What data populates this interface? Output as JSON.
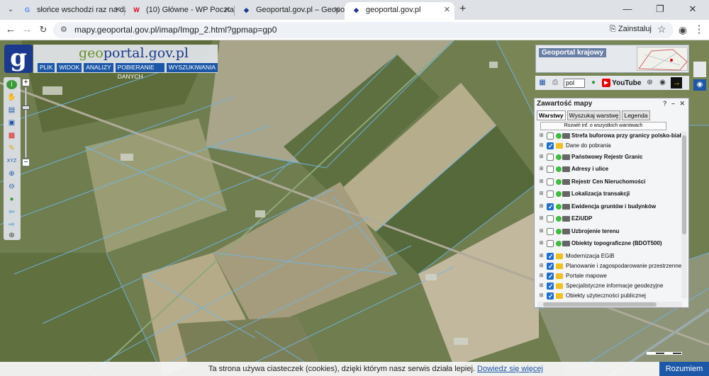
{
  "browser": {
    "tabs": [
      {
        "title": "słońce wschodzi raz na dzień -",
        "favicon": "G",
        "fav_color": "#4285f4",
        "active": false
      },
      {
        "title": "(10) Główne - WP Poczta",
        "favicon": "W",
        "fav_color": "#e2001a",
        "active": false
      },
      {
        "title": "Geoportal.gov.pl – Geoportal In",
        "favicon": "◆",
        "fav_color": "#1b3a8f",
        "active": false
      },
      {
        "title": "geoportal.gov.pl",
        "favicon": "◆",
        "fav_color": "#1b3a8f",
        "active": true
      }
    ],
    "url": "mapy.geoportal.gov.pl/imap/Imgp_2.html?gpmap=gp0",
    "install_label": "Zainstaluj"
  },
  "geoportal": {
    "brand_prefix": "geo",
    "brand_suffix": "portal.gov.pl",
    "menu": [
      "PLIK",
      "WIDOK",
      "ANALIZY",
      "POBIERANIE DANYCH",
      "WYSZUKIWANIA"
    ],
    "overview_title": "Geoportal krajowy",
    "lang": "pol",
    "youtube_label": "YouTube"
  },
  "panel": {
    "title": "Zawartość mapy",
    "tabs": [
      "Warstwy",
      "Wyszukaj warstwę",
      "Legenda"
    ],
    "expand_button": "Rozwiń inf. o wszystkich warstwach",
    "layers": [
      {
        "name": "Strefa buforowa przy granicy polsko-białor",
        "kind": "service",
        "checked": false,
        "bold": true
      },
      {
        "name": "Dane do pobrania",
        "kind": "folder",
        "checked": true,
        "bold": false
      },
      {
        "name": "Państwowy Rejestr Granic",
        "kind": "service",
        "checked": false,
        "bold": true
      },
      {
        "name": "Adresy i ulice",
        "kind": "service",
        "checked": false,
        "bold": true
      },
      {
        "name": "Rejestr Cen Nieruchomości",
        "kind": "service",
        "checked": false,
        "bold": true
      },
      {
        "name": "Lokalizacja transakcji",
        "kind": "service",
        "checked": false,
        "bold": true
      },
      {
        "name": "Ewidencja gruntów i budynków",
        "kind": "service",
        "checked": true,
        "bold": true
      },
      {
        "name": "EZiUDP",
        "kind": "service",
        "checked": false,
        "bold": true
      },
      {
        "name": "Uzbrojenie terenu",
        "kind": "service",
        "checked": false,
        "bold": true
      },
      {
        "name": "Obiekty topograficzne (BDOT500)",
        "kind": "service",
        "checked": false,
        "bold": true
      },
      {
        "name": "Modernizacja EGiB",
        "kind": "folder",
        "checked": true,
        "bold": false
      },
      {
        "name": "Planowanie i zagospodarowanie przestrzenne",
        "kind": "folder",
        "checked": true,
        "bold": false
      },
      {
        "name": "Portale mapowe",
        "kind": "folder",
        "checked": true,
        "bold": false
      },
      {
        "name": "Specjalistyczne informacje geodezyjne",
        "kind": "folder",
        "checked": true,
        "bold": false
      },
      {
        "name": "Obiekty użyteczności publicznej",
        "kind": "folder",
        "checked": true,
        "bold": false
      }
    ]
  },
  "cookie": {
    "text": "Ta strona używa ciasteczek (cookies), dzięki którym nasz serwis działa lepiej.",
    "link": "Dowiedz się więcej",
    "button": "Rozumiem"
  }
}
